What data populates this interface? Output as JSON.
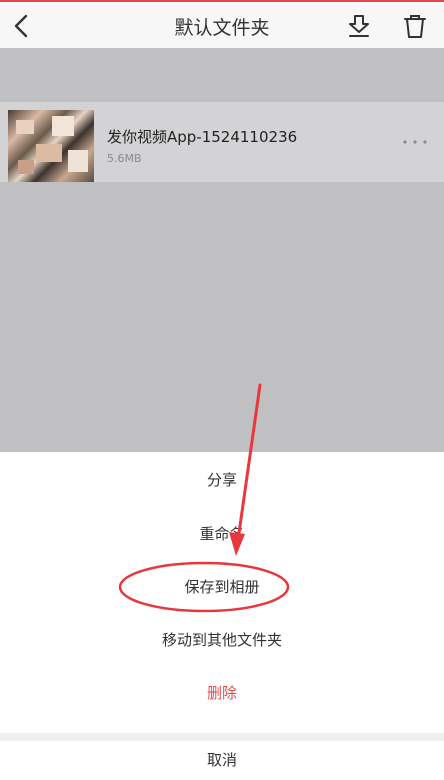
{
  "header": {
    "title": "默认文件夹",
    "back_icon": "chevron-left-icon",
    "download_icon": "download-icon",
    "delete_icon": "trash-icon"
  },
  "file": {
    "name": "发你视频App-1524110236",
    "size": "5.6MB",
    "more_icon": "more-icon"
  },
  "action_sheet": {
    "share": "分享",
    "rename": "重命名",
    "save_to_album": "保存到相册",
    "move_to_folder": "移动到其他文件夹",
    "delete": "删除",
    "cancel": "取消"
  },
  "colors": {
    "accent_red": "#e24b4b",
    "annotation_red": "#e8383d",
    "overlay_gray": "#c0bfc1"
  }
}
